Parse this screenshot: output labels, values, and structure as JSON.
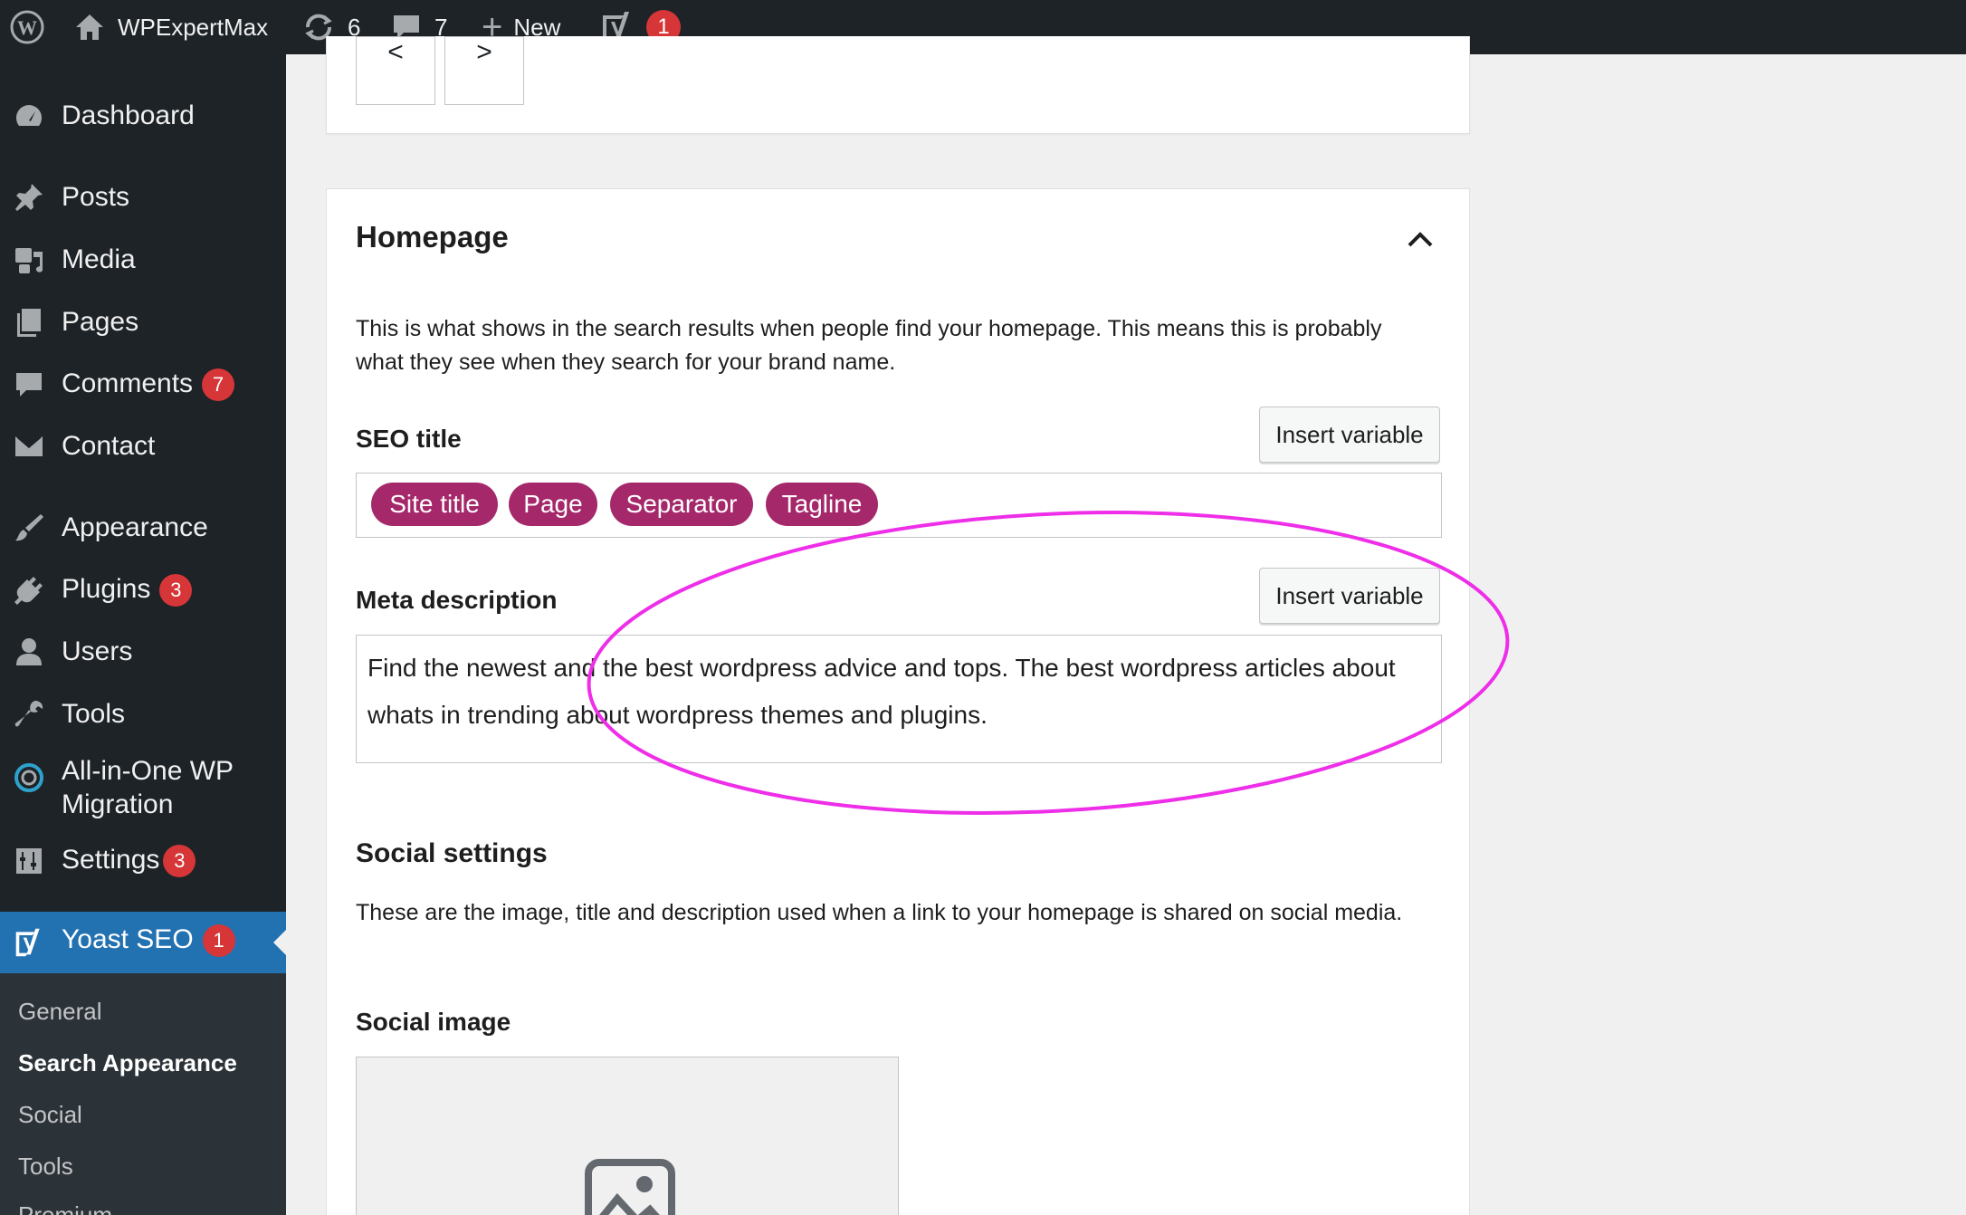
{
  "admin_bar": {
    "site_name": "WPExpertMax",
    "updates_count": "6",
    "comments_count": "7",
    "new_label": "New",
    "yoast_count": "1"
  },
  "sidebar": {
    "items": [
      {
        "label": "Dashboard",
        "icon": "dashboard-icon"
      },
      {
        "label": "Posts",
        "icon": "pin-icon"
      },
      {
        "label": "Media",
        "icon": "media-icon"
      },
      {
        "label": "Pages",
        "icon": "pages-icon"
      },
      {
        "label": "Comments",
        "icon": "comment-icon",
        "badge": "7"
      },
      {
        "label": "Contact",
        "icon": "envelope-icon"
      },
      {
        "label": "Appearance",
        "icon": "paintbrush-icon"
      },
      {
        "label": "Plugins",
        "icon": "plugin-icon",
        "badge": "3"
      },
      {
        "label": "Users",
        "icon": "user-icon"
      },
      {
        "label": "Tools",
        "icon": "wrench-icon"
      },
      {
        "label": "All-in-One WP Migration",
        "icon": "migration-icon"
      },
      {
        "label": "Settings",
        "icon": "settings-icon",
        "badge": "3"
      }
    ],
    "yoast": {
      "label": "Yoast SEO",
      "badge": "1"
    },
    "submenu": [
      "General",
      "Search Appearance",
      "Social",
      "Tools",
      "Premium"
    ]
  },
  "pagination": {
    "prev": "<",
    "next": ">"
  },
  "homepage": {
    "title": "Homepage",
    "description": "This is what shows in the search results when people find your homepage. This means this is probably what they see when they search for your brand name.",
    "seo_title_label": "SEO title",
    "insert_variable": "Insert variable",
    "seo_title_tags": [
      "Site title",
      "Page",
      "Separator",
      "Tagline"
    ],
    "meta_label": "Meta description",
    "meta_value": "Find the newest and the best wordpress advice and tops. The best wordpress articles about whats in trending about wordpress themes and plugins.",
    "social_title": "Social settings",
    "social_description": "These are the image, title and description used when a link to your homepage is shared on social media.",
    "social_image_label": "Social image"
  },
  "colors": {
    "admin_dark": "#1d2327",
    "accent_blue": "#2271b1",
    "badge_red": "#d63638",
    "tag_purple": "#a4286a",
    "annotation_magenta": "#ee2ee8"
  }
}
